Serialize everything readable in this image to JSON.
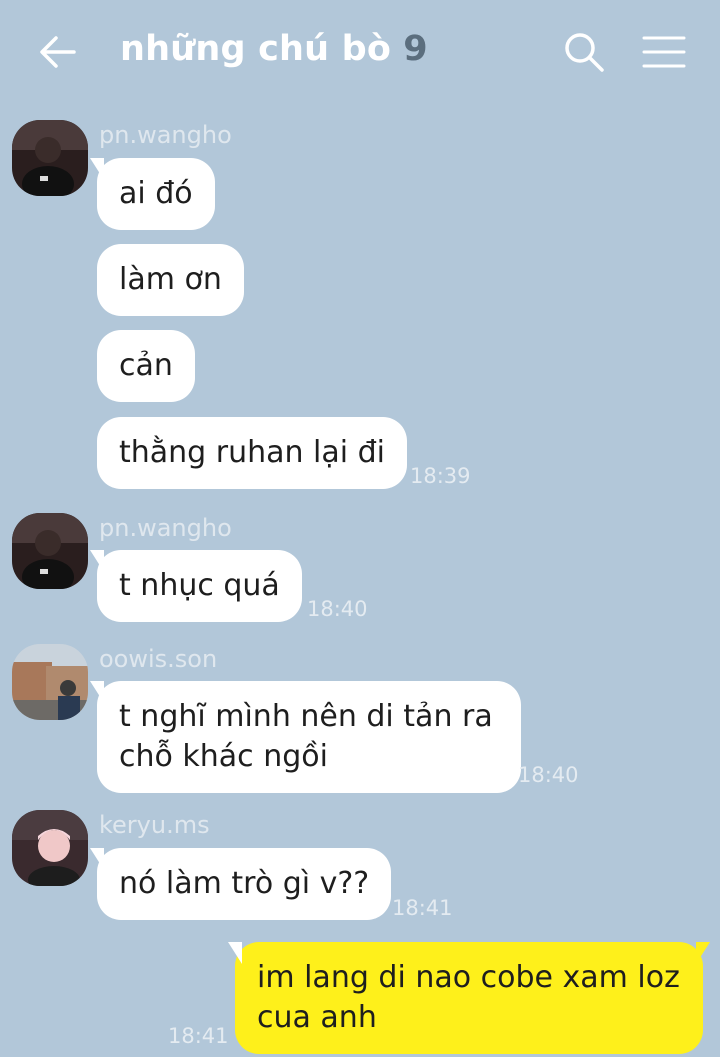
{
  "header": {
    "title": "những chú bò",
    "member_count": "9",
    "back_icon": "arrow-left-icon",
    "search_icon": "search-icon",
    "menu_icon": "hamburger-menu-icon"
  },
  "messages": [
    {
      "sender": "pn.wangho",
      "bubbles": [
        "ai đó",
        "làm ơn",
        "cản",
        "thằng ruhan lại đi"
      ],
      "time": "18:39"
    },
    {
      "sender": "pn.wangho",
      "bubbles": [
        "t nhục quá"
      ],
      "time": "18:40"
    },
    {
      "sender": "oowis.son",
      "bubbles": [
        "t nghĩ mình nên di tản ra\nchỗ khác ngồi"
      ],
      "time": "18:40"
    },
    {
      "sender": "keryu.ms",
      "bubbles": [
        "nó làm trò gì v??"
      ],
      "time": "18:41"
    }
  ],
  "my_message": {
    "text": "im lang di nao cobe xam loz\ncua anh",
    "time": "18:41"
  },
  "colors": {
    "background": "#b2c7d9",
    "my_bubble": "#fef01b",
    "other_bubble": "#ffffff"
  }
}
